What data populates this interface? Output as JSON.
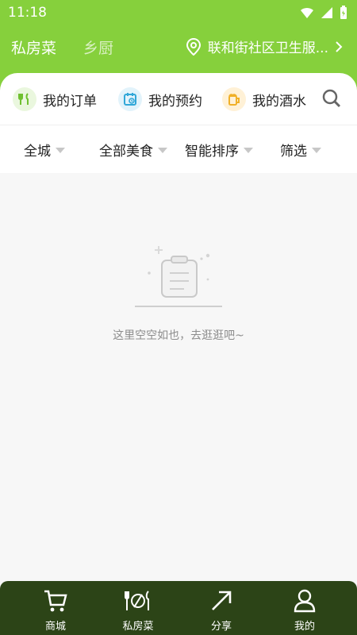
{
  "status": {
    "time": "11:18"
  },
  "header": {
    "tabs": [
      {
        "label": "私房菜",
        "active": true
      },
      {
        "label": "乡厨",
        "active": false
      }
    ],
    "location": "联和街社区卫生服..."
  },
  "quick_actions": [
    {
      "label": "我的订单",
      "icon": "fork-knife-icon"
    },
    {
      "label": "我的预约",
      "icon": "calendar-clock-icon"
    },
    {
      "label": "我的酒水",
      "icon": "beer-mug-icon"
    }
  ],
  "filters": [
    "全城",
    "全部美食",
    "智能排序",
    "筛选"
  ],
  "empty_state": {
    "text": "这里空空如也，去逛逛吧~"
  },
  "bottom_nav": [
    {
      "label": "商城",
      "icon": "cart-icon"
    },
    {
      "label": "私房菜",
      "icon": "dining-icon"
    },
    {
      "label": "分享",
      "icon": "share-arrow-icon"
    },
    {
      "label": "我的",
      "icon": "user-icon"
    }
  ],
  "colors": {
    "header_green": "#86d03c",
    "bottom_nav_bg": "#2c4417",
    "muted_text": "#8d8d8d"
  }
}
